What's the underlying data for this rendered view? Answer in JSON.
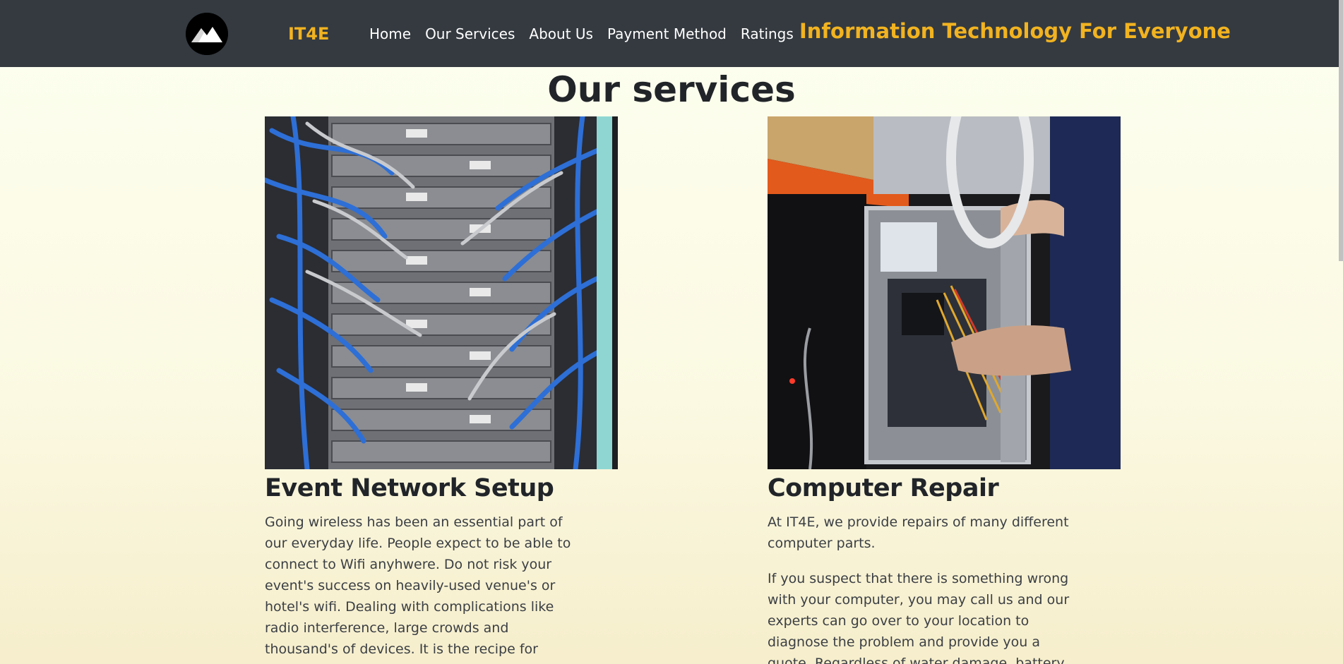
{
  "nav": {
    "brand": "IT4E",
    "links": [
      "Home",
      "Our Services",
      "About Us",
      "Payment Method",
      "Ratings"
    ],
    "tagline": "Information Technology For Everyone"
  },
  "main": {
    "title": "Our services",
    "services": [
      {
        "title": "Event Network Setup",
        "image": "server-rack-photo",
        "paragraphs": [
          "Going wireless has been an essential part of our everyday life. People expect to be able to connect to Wifi anyhwere. Do not risk your event's success on heavily-used venue's or hotel's wifi. Dealing with complications like radio interference, large crowds and thousand's of devices. It is the recipe for disaster."
        ]
      },
      {
        "title": "Computer Repair",
        "image": "computer-repair-photo",
        "paragraphs": [
          "At IT4E, we provide repairs of many different computer parts.",
          "If you suspect that there is something wrong with your computer, you may call us and our experts can go over to your location to diagnose the problem and provide you a quote. Regardless of water damage, battery issues, Virus and Malware"
        ]
      }
    ]
  },
  "colors": {
    "navbar": "#343a40",
    "accent": "#f2b320",
    "text": "#212529"
  }
}
